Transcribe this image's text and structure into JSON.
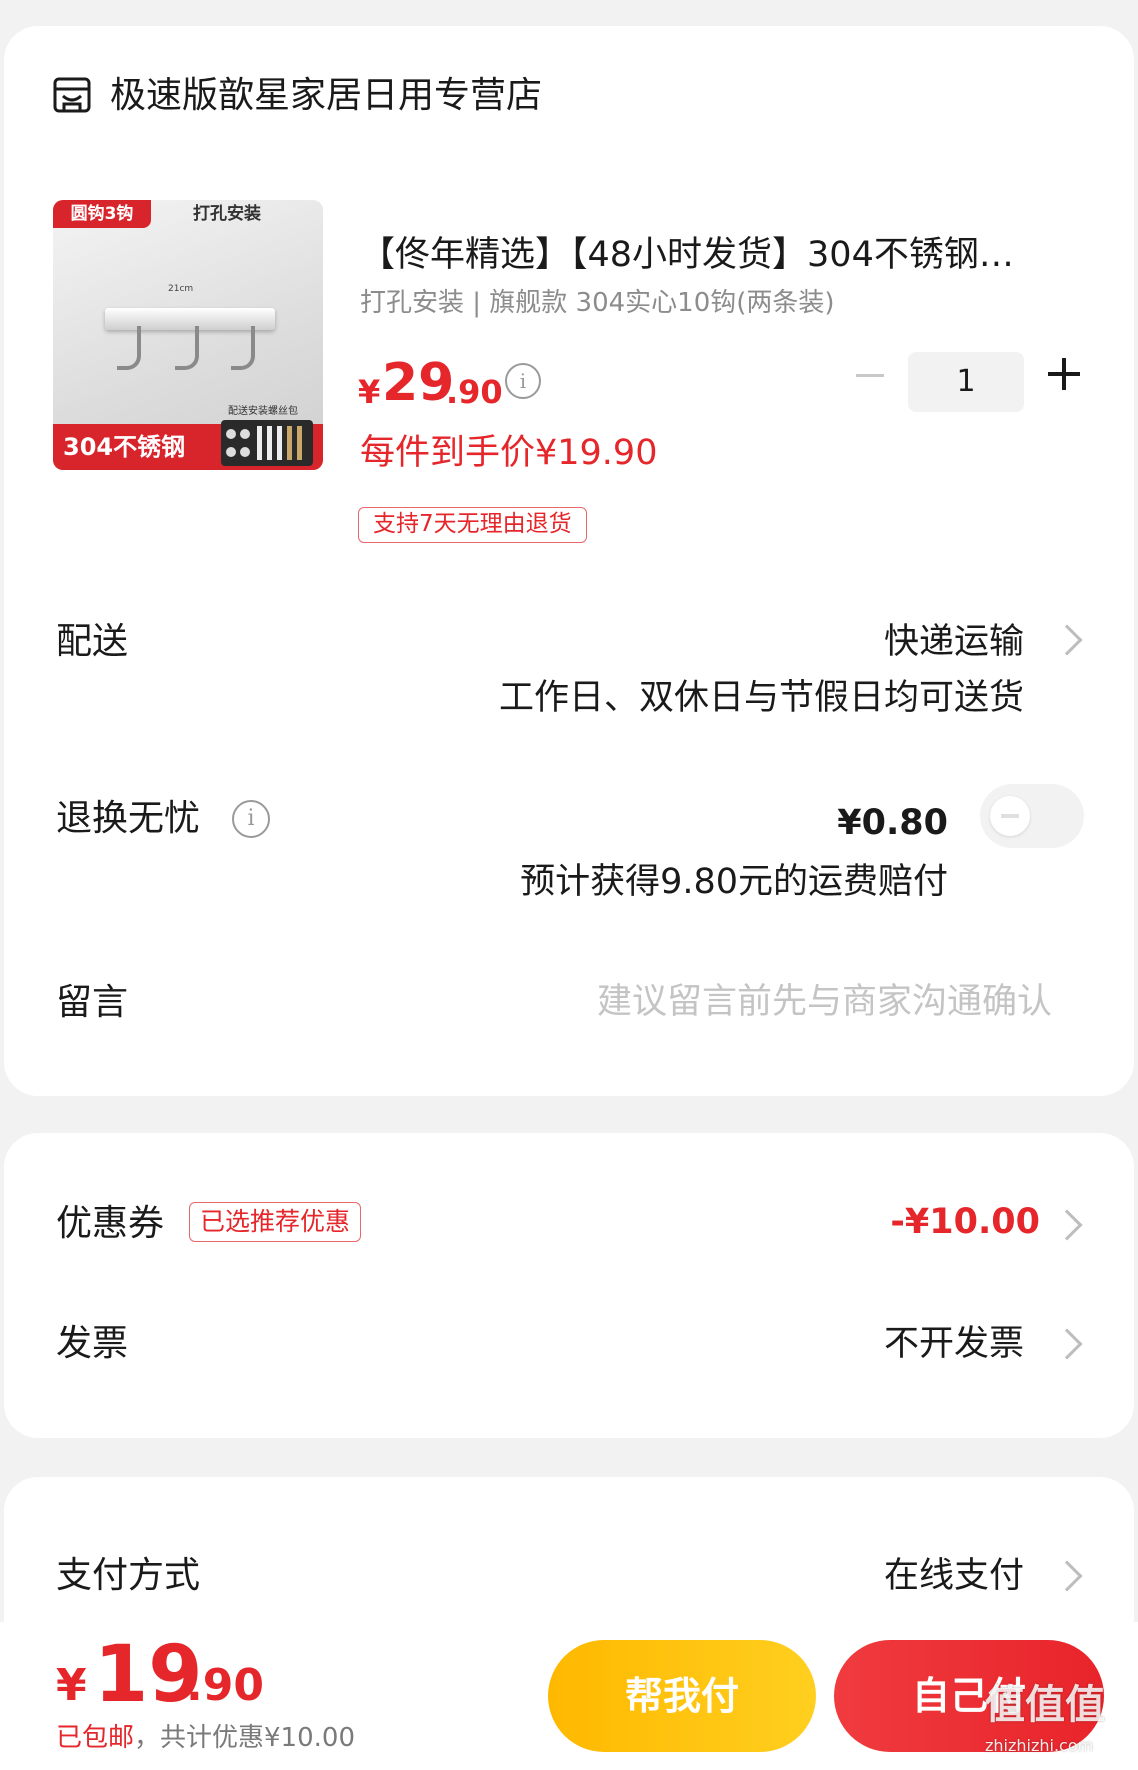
{
  "shop": {
    "icon": "shop-icon",
    "name": "极速版歆星家居日用专营店"
  },
  "product": {
    "image": {
      "tag_top": "圆钩3钩",
      "tag_right": "打孔安装",
      "bottom_label": "304不锈钢",
      "kit_label": "配送安装螺丝包",
      "dimension": "21cm"
    },
    "title": "【佟年精选】【48小时发货】304不锈钢…",
    "sku": "打孔安装 | 旗舰款 304实心10钩(两条装)",
    "price": {
      "symbol": "¥",
      "integer": "29",
      "decimal": ".90",
      "info_icon": "i"
    },
    "quantity": "1",
    "unit_price": "每件到手价¥19.90",
    "return_tag": "支持7天无理由退货"
  },
  "delivery": {
    "label": "配送",
    "value": "快递运输",
    "note": "工作日、双休日与节假日均可送货"
  },
  "return_insurance": {
    "label": "退换无忧",
    "info_icon": "i",
    "price": "¥0.80",
    "note": "预计获得9.80元的运费赔付",
    "enabled": false
  },
  "message": {
    "label": "留言",
    "placeholder": "建议留言前先与商家沟通确认"
  },
  "coupon": {
    "label": "优惠券",
    "tag": "已选推荐优惠",
    "value": "-¥10.00"
  },
  "invoice": {
    "label": "发票",
    "value": "不开发票"
  },
  "payment": {
    "label": "支付方式",
    "value": "在线支付"
  },
  "bottom": {
    "total_symbol": "¥",
    "total_integer": "19",
    "total_decimal": ".90",
    "shipping_note": "已包邮",
    "discount_note": "，共计优惠¥10.00",
    "btn_help": "帮我付",
    "btn_self": "自己付"
  },
  "watermark": {
    "text": "值值值",
    "sub": "zhizhizhi.com"
  },
  "colors": {
    "accent_red": "#e5262a",
    "help_button": "#ffc107",
    "background": "#f2f2f2"
  }
}
